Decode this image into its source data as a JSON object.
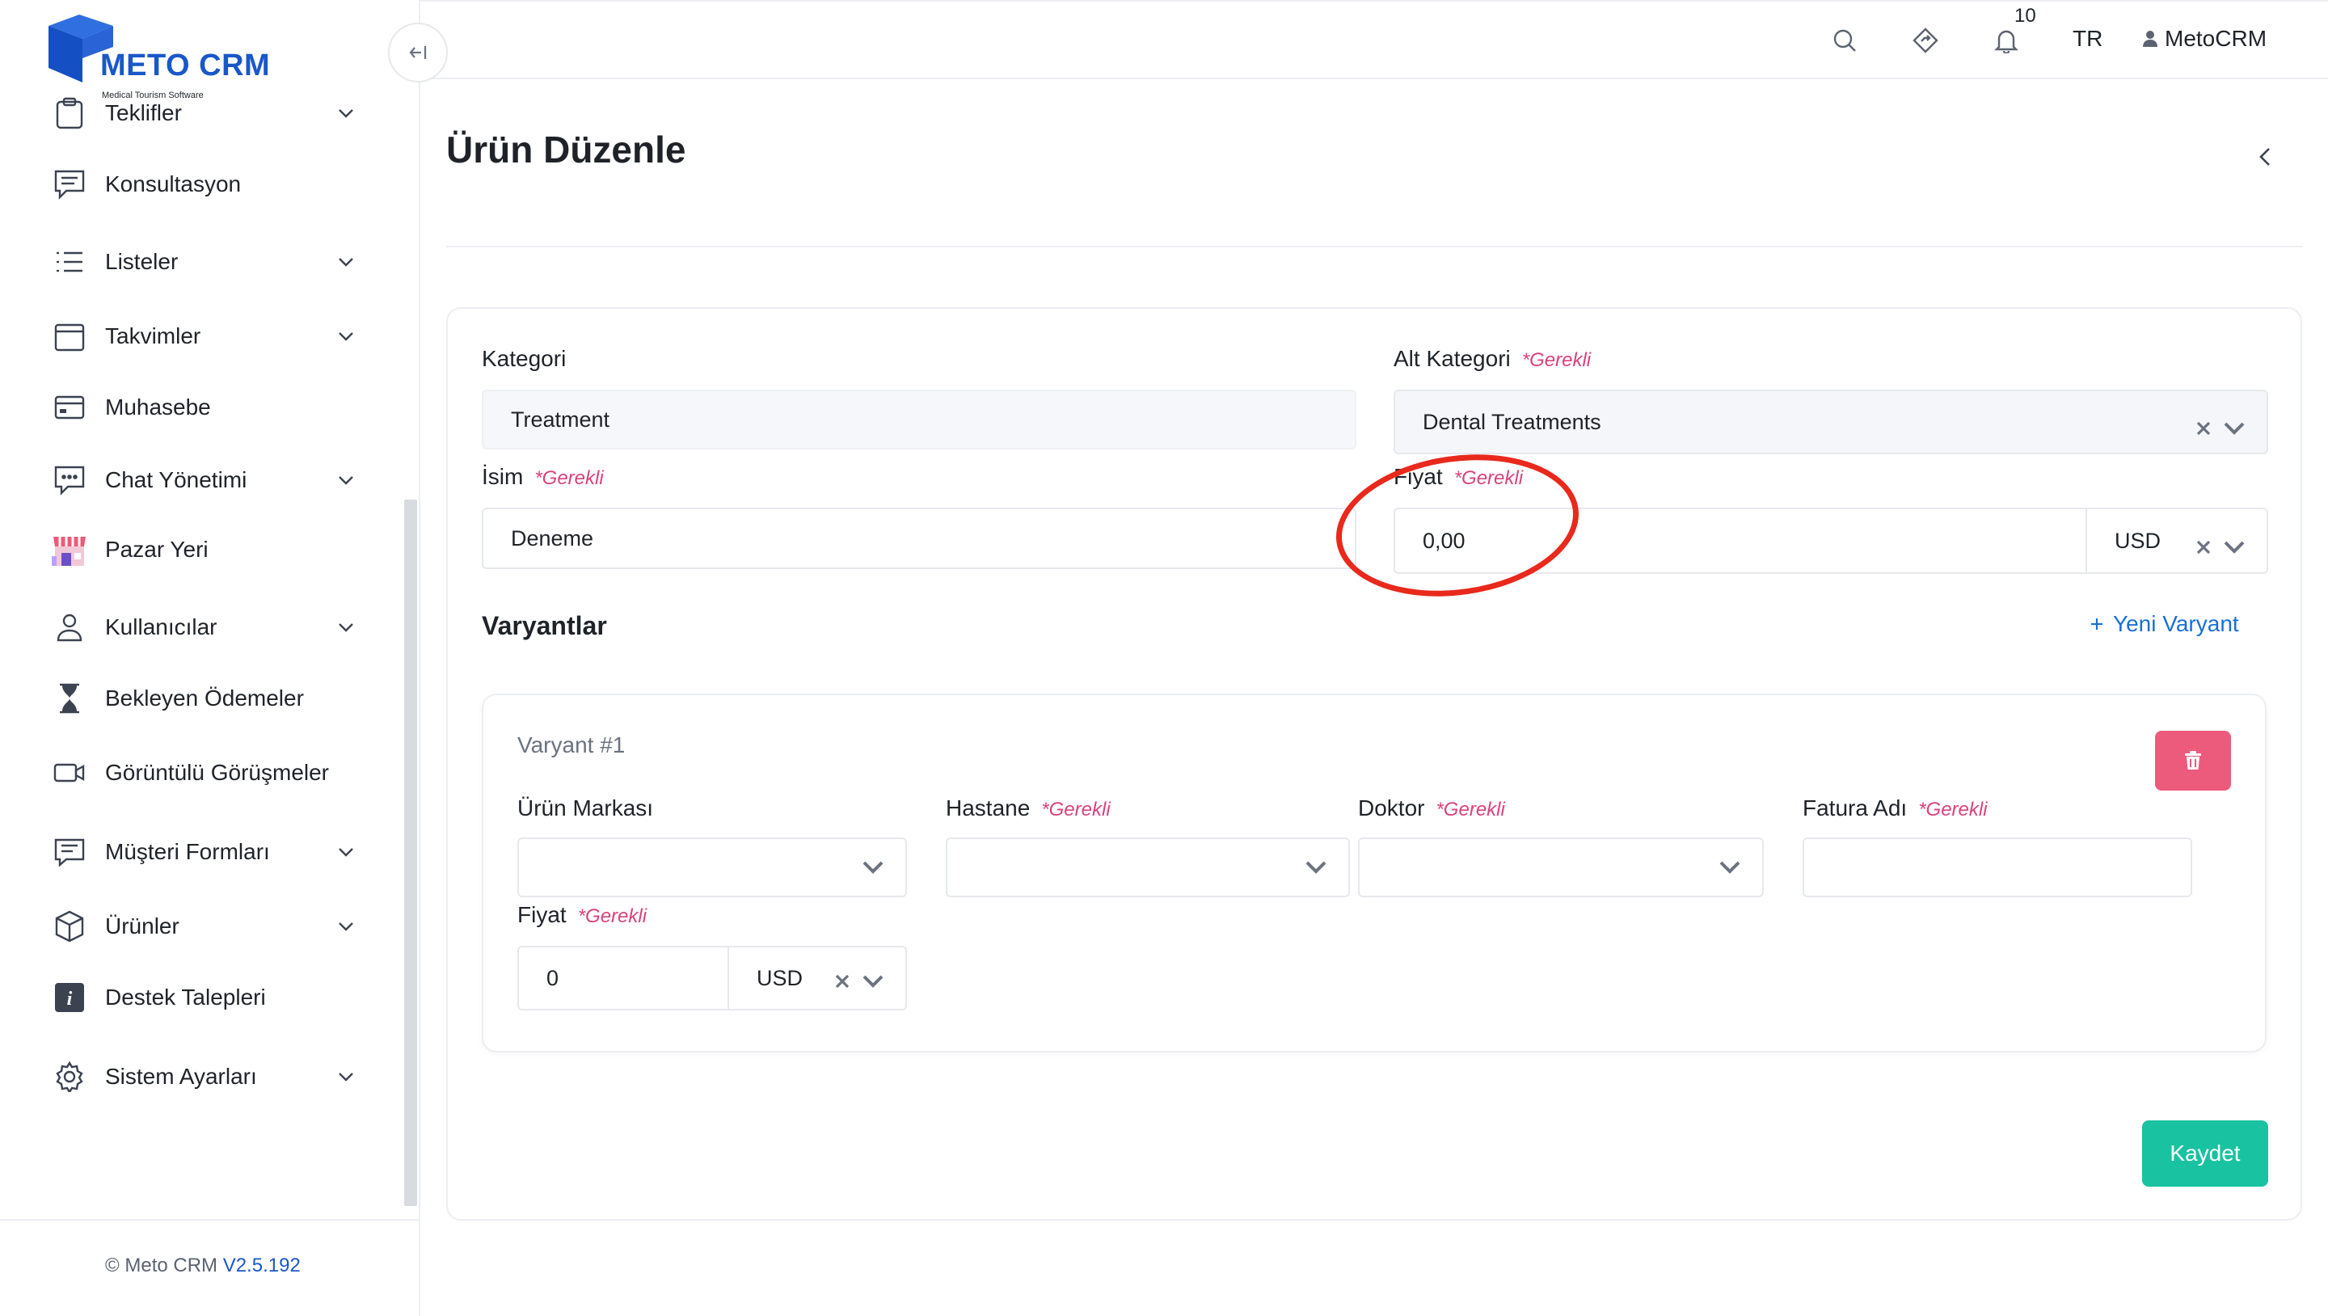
{
  "app": {
    "brand": "METO CRM",
    "tagline": "Medical Tourism Software",
    "footer_prefix": "© Meto CRM",
    "version": "V2.5.192"
  },
  "sidebar": {
    "items": [
      {
        "label": "Teklifler",
        "icon": "clipboard-icon",
        "has_submenu": true
      },
      {
        "label": "Konsultasyon",
        "icon": "message-icon",
        "has_submenu": false
      },
      {
        "label": "Listeler",
        "icon": "list-icon",
        "has_submenu": true
      },
      {
        "label": "Takvimler",
        "icon": "calendar-icon",
        "has_submenu": true
      },
      {
        "label": "Muhasebe",
        "icon": "credit-card-icon",
        "has_submenu": false
      },
      {
        "label": "Chat Yönetimi",
        "icon": "chat-icon",
        "has_submenu": true
      },
      {
        "label": "Pazar Yeri",
        "icon": "store-icon",
        "has_submenu": false
      },
      {
        "label": "Kullanıcılar",
        "icon": "user-icon",
        "has_submenu": true
      },
      {
        "label": "Bekleyen Ödemeler",
        "icon": "hourglass-icon",
        "has_submenu": false
      },
      {
        "label": "Görüntülü Görüşmeler",
        "icon": "video-icon",
        "has_submenu": false
      },
      {
        "label": "Müşteri Formları",
        "icon": "form-icon",
        "has_submenu": true
      },
      {
        "label": "Ürünler",
        "icon": "box-icon",
        "has_submenu": true
      },
      {
        "label": "Destek Talepleri",
        "icon": "info-icon",
        "has_submenu": false
      },
      {
        "label": "Sistem Ayarları",
        "icon": "gear-icon",
        "has_submenu": true
      }
    ]
  },
  "topbar": {
    "notification_count": "10",
    "language": "TR",
    "user_name": "MetoCRM"
  },
  "page": {
    "title": "Ürün Düzenle"
  },
  "form": {
    "required_text": "*Gerekli",
    "category_label": "Kategori",
    "category_value": "Treatment",
    "subcategory_label": "Alt Kategori",
    "subcategory_value": "Dental Treatments",
    "name_label": "İsim",
    "name_value": "Deneme",
    "price_label": "Fiyat",
    "price_value": "0,00",
    "price_currency": "USD",
    "variants_title": "Varyantlar",
    "new_variant_label": "Yeni Varyant",
    "save_label": "Kaydet"
  },
  "variant": {
    "title": "Varyant #1",
    "brand_label": "Ürün Markası",
    "hospital_label": "Hastane",
    "doctor_label": "Doktor",
    "invoice_label": "Fatura Adı",
    "price_label": "Fiyat",
    "price_value": "0",
    "price_currency": "USD"
  },
  "colors": {
    "brand_blue": "#1a57c9",
    "link_blue": "#1a6fd6",
    "required_pink": "#d9437a",
    "delete_pink": "#ec5a7c",
    "save_green": "#19c2a0",
    "annotation_red": "#e8291c"
  }
}
